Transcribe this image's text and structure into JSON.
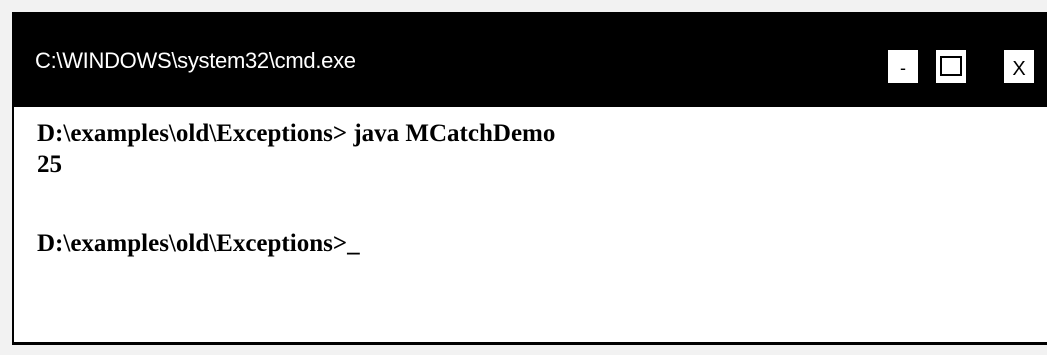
{
  "window": {
    "title": "C:\\WINDOWS\\system32\\cmd.exe",
    "controls": {
      "minimize": "-",
      "close": "X"
    }
  },
  "console": {
    "lines": [
      "D:\\examples\\old\\Exceptions> java MCatchDemo",
      "25",
      "D:\\examples\\old\\Exceptions>_"
    ]
  }
}
